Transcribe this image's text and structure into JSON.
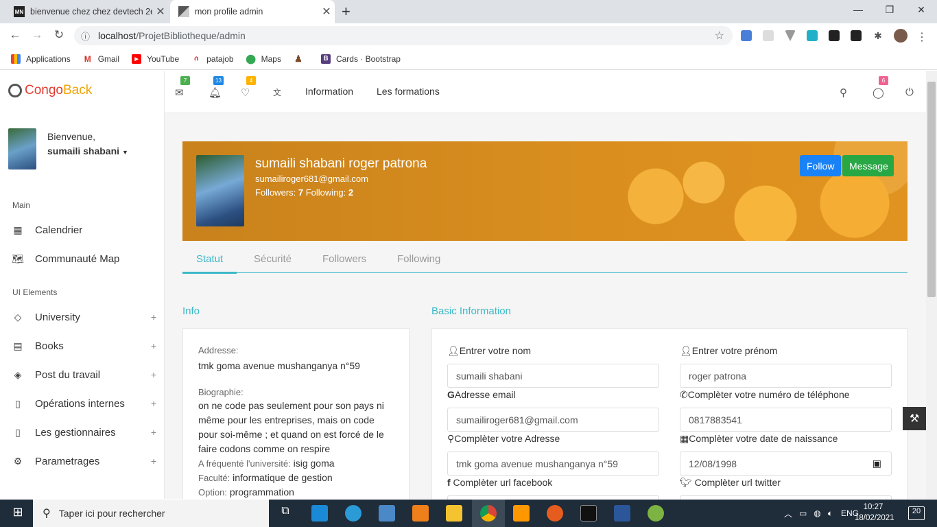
{
  "browser": {
    "tabs": [
      {
        "title": "bienvenue chez chez devtech 2e",
        "favicon": "MN"
      },
      {
        "title": "mon profile admin"
      }
    ],
    "url_host": "localhost",
    "url_path": "/ProjetBibliotheque/admin",
    "bookmarks": [
      "Applications",
      "Gmail",
      "YouTube",
      "patajob",
      "Maps",
      "",
      "Cards · Bootstrap"
    ]
  },
  "sidebar": {
    "logo_part1": "Congo",
    "logo_part2": "Back",
    "welcome": "Bienvenue,",
    "username": "sumaili shabani",
    "section_main": "Main",
    "main_items": [
      "Calendrier",
      "Communauté Map"
    ],
    "section_ui": "UI Elements",
    "ui_items": [
      "University",
      "Books",
      "Post du travail",
      "Opérations internes",
      "Les gestionnaires",
      "Parametrages"
    ]
  },
  "topnav": {
    "badges": {
      "mail": "7",
      "bell": "13",
      "heart": "4",
      "chat": "6"
    },
    "links": [
      "Information",
      "Les formations"
    ]
  },
  "profile": {
    "name": "sumaili shabani roger patrona",
    "email": "sumailiroger681@gmail.com",
    "followers_label": "Followers:",
    "followers": "7",
    "following_label": "Following:",
    "following": "2",
    "follow_button": "Follow",
    "message_button": "Message",
    "tabs": [
      "Statut",
      "Sécurité",
      "Followers",
      "Following"
    ]
  },
  "info": {
    "heading": "Info",
    "address_label": "Addresse:",
    "address": "tmk goma avenue mushanganya n°59",
    "bio_label": "Biographie:",
    "bio": "on ne code pas seulement  pour son pays ni même pour les entreprises, mais on code pour soi-même ; et quand on est forcé de le faire codons comme on respire",
    "university_label": "A fréquenté l'université:",
    "university": "isig goma",
    "faculty_label": "Faculté:",
    "faculty": "informatique de gestion",
    "option_label": "Option:",
    "option": "programmation"
  },
  "basic": {
    "heading": "Basic Information",
    "nom_label": "Entrer votre nom",
    "nom_value": "sumaili shabani",
    "prenom_label": "Entrer votre prénom",
    "prenom_value": "roger patrona",
    "email_label": "Adresse email",
    "email_value": "sumailiroger681@gmail.com",
    "phone_label": "Complèter votre numéro de téléphone",
    "phone_value": "0817883541",
    "adresse_label": "Complèter votre Adresse",
    "adresse_value": "tmk goma avenue mushanganya n°59",
    "naissance_label": "Complèter votre date de naissance",
    "naissance_value": "12/08/1998",
    "facebook_label": " Complèter url facebook",
    "twitter_label": " Complèter url twitter"
  },
  "taskbar": {
    "search_placeholder": "Taper ici pour rechercher",
    "lang": "ENG",
    "time": "10:27",
    "date": "18/02/2021",
    "notifications": "20"
  }
}
